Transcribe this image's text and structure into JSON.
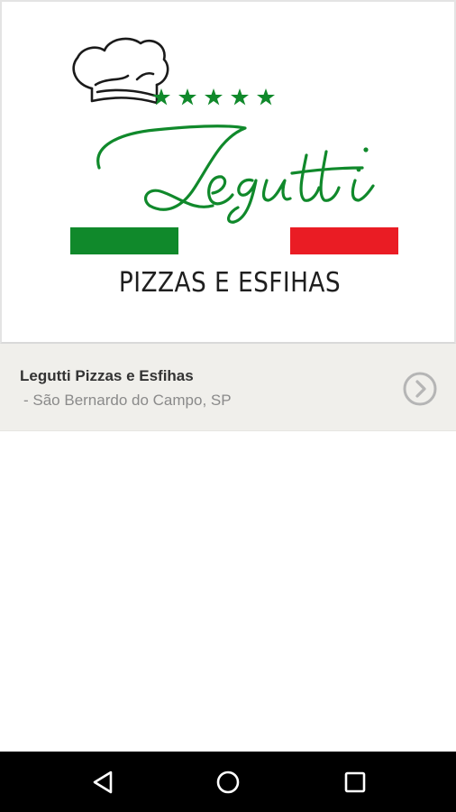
{
  "logo": {
    "brand_script": "Legutti",
    "tagline": "PIZZAS E ESFIHAS",
    "stars": 5,
    "colors": {
      "green": "#10892b",
      "red": "#ea1c24",
      "text": "#1f1f1f"
    },
    "icons": [
      "chef-hat-icon",
      "star-icon"
    ]
  },
  "stores": [
    {
      "name": "Legutti Pizzas e Esfihas",
      "location": " - São Bernardo do Campo, SP",
      "action_icon": "chevron-right-circle-icon"
    }
  ],
  "navigation": {
    "back_icon": "back-triangle-icon",
    "home_icon": "home-circle-icon",
    "recents_icon": "recents-square-icon"
  }
}
